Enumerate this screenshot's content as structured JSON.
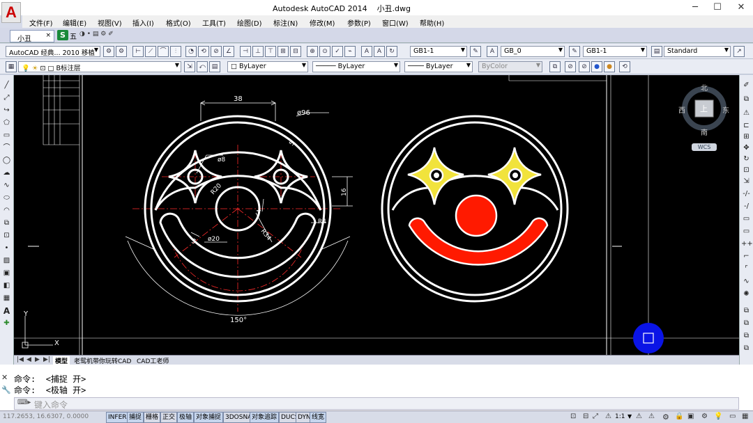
{
  "window": {
    "title": "Autodesk AutoCAD 2014",
    "document": "小丑.dwg",
    "app_icon": "A",
    "controls": {
      "minimize": "─",
      "maximize": "☐",
      "close": "✕"
    }
  },
  "menu": [
    "文件(F)",
    "编辑(E)",
    "视图(V)",
    "插入(I)",
    "格式(O)",
    "工具(T)",
    "绘图(D)",
    "标注(N)",
    "修改(M)",
    "参数(P)",
    "窗口(W)",
    "帮助(H)"
  ],
  "doc_tab": {
    "label": "小丑",
    "close": "×"
  },
  "ime_label": "五",
  "toolbar": {
    "workspace": "AutoCAD 经典",
    "workspace_extra": "2010 移植",
    "text_style": "GB1-1",
    "dim_style": "GB_0",
    "table_style": "GB1-1",
    "multileader_style": "Standard",
    "layer": "B标注层",
    "color": "ByLayer",
    "linetype": "ByLayer",
    "lineweight": "ByLayer",
    "plotstyle": "ByColor"
  },
  "drawing": {
    "dims": {
      "d38": "38",
      "d96": "ø96",
      "d8": "ø8",
      "r20": "R20",
      "d16": "16",
      "r4": "R4",
      "r34": "R34",
      "d20": "ø20",
      "d5a": "5",
      "d5b": "5",
      "d4": "4",
      "a150": "150°"
    },
    "colors": {
      "outline": "#ffffff",
      "eye_fill": "#f1e33c",
      "nose_fill": "#ff1a00",
      "mouth_fill": "#ff1a00",
      "centerline": "#ff2a2a",
      "cursor": "#0a14e6"
    }
  },
  "viewcube": {
    "north": "北",
    "south": "南",
    "east": "东",
    "west": "西",
    "face": "上",
    "wcs": "WCS"
  },
  "layout_tabs": [
    "模型",
    "老鸳机带你玩转CAD",
    "CAD工老师"
  ],
  "command": {
    "lines": [
      {
        "prompt": "命令:",
        "text": "<捕捉 开>"
      },
      {
        "prompt": "命令:",
        "text": "<极轴 开>"
      }
    ],
    "placeholder": "键入命令"
  },
  "status": {
    "coords": "117.2653, 16.6307, 0.0000",
    "buttons": [
      "INFER",
      "捕捉",
      "栅格",
      "正交",
      "极轴",
      "对象捕捉",
      "3DOSNAP",
      "对象追踪",
      "DUCS",
      "DYN",
      "线宽"
    ],
    "scale": "1:1"
  }
}
